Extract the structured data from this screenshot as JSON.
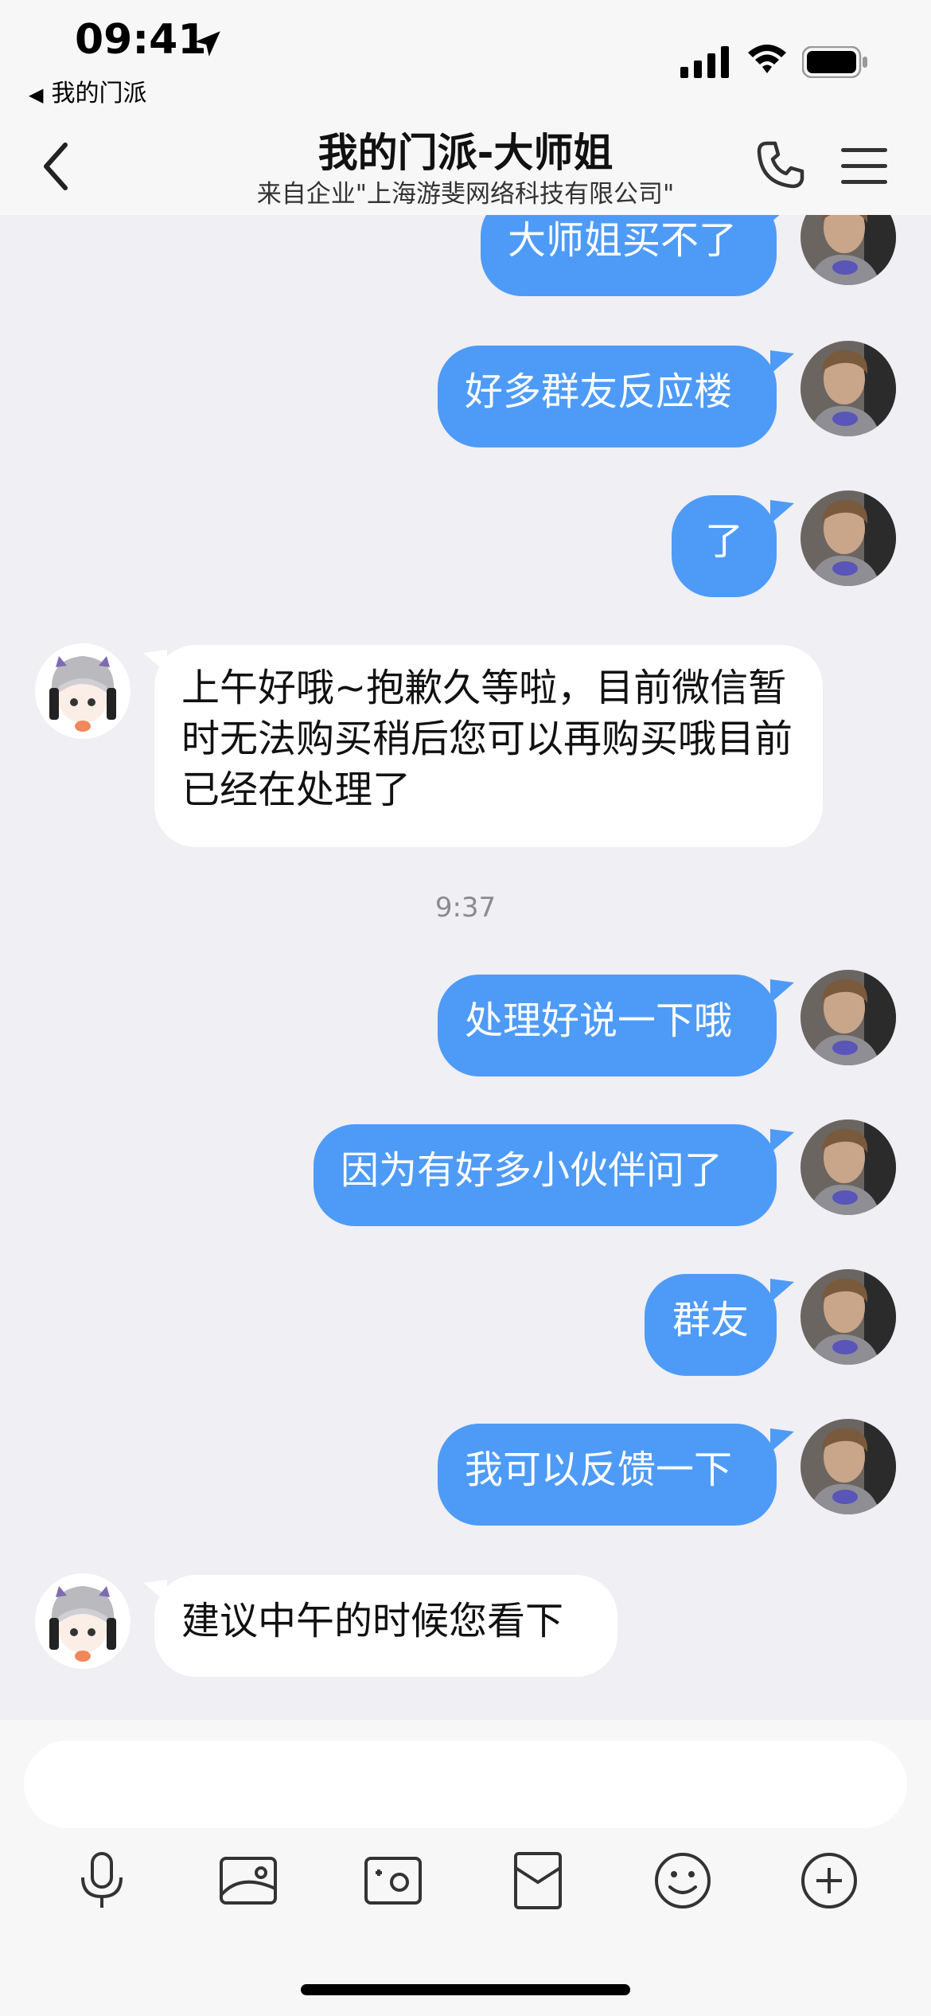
{
  "status_bar": {
    "time": "09:41",
    "back_app": "我的门派"
  },
  "header": {
    "title": "我的门派-大师姐",
    "subtitle": "来自企业\"上海游斐网络科技有限公司\""
  },
  "messages": [
    {
      "side": "out",
      "text": "大师姐买不了"
    },
    {
      "side": "out",
      "text": "好多群友反应楼"
    },
    {
      "side": "out",
      "text": "了"
    },
    {
      "side": "in",
      "text": "上午好哦~抱歉久等啦，目前微信暂时无法购买稍后您可以再购买哦目前已经在处理了"
    },
    {
      "side": "time",
      "text": "9:37"
    },
    {
      "side": "out",
      "text": "处理好说一下哦"
    },
    {
      "side": "out",
      "text": "因为有好多小伙伴问了"
    },
    {
      "side": "out",
      "text": "群友"
    },
    {
      "side": "out",
      "text": "我可以反馈一下"
    },
    {
      "side": "in",
      "text": "建议中午的时候您看下"
    }
  ],
  "composer": {
    "input_value": "",
    "tools": [
      "microphone-icon",
      "image-icon",
      "camera-icon",
      "redpacket-icon",
      "emoji-icon",
      "plus-icon"
    ]
  },
  "colors": {
    "outgoing_bubble": "#4e9bf7",
    "incoming_bubble": "#ffffff",
    "background": "#efeff4"
  }
}
